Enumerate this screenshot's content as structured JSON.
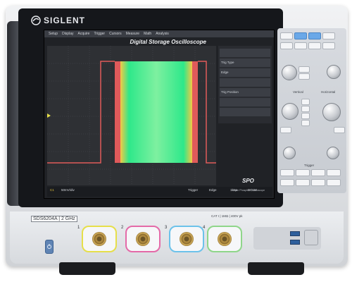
{
  "brand": {
    "name": "SIGLENT"
  },
  "screen": {
    "title": "Digital Storage Oscilloscope",
    "menu": [
      "Setup",
      "Display",
      "Acquire",
      "Trigger",
      "Cursors",
      "Measure",
      "Math",
      "Analysis"
    ],
    "right_panel": {
      "rows": [
        "",
        "Trig Type",
        "Edge",
        "",
        "Trig Position",
        "",
        "",
        ""
      ]
    },
    "status_items": [
      "C1",
      "50mV/div",
      "Trigger",
      "Edge",
      "1kSa",
      "DC1M"
    ],
    "waveform_colors": {
      "trace": "#e05a5a",
      "fill_mid": "#2ee88a",
      "fill_edge": "#f5c845"
    }
  },
  "controls": {
    "labels": [
      "Vertical",
      "Horizontal",
      "Trigger"
    ]
  },
  "bottom": {
    "model": "SDS6204A | 2 GHz",
    "channels": [
      {
        "num": "1",
        "color": "#e6df4a"
      },
      {
        "num": "2",
        "color": "#e46aa8"
      },
      {
        "num": "3",
        "color": "#6cc2ea"
      },
      {
        "num": "4",
        "color": "#8fd68a"
      }
    ],
    "warning_text": "CAT I | 1MΩ | 400V pk",
    "super_phosphor": "Super Phosphor Oscilloscope",
    "epo": "SPO"
  }
}
